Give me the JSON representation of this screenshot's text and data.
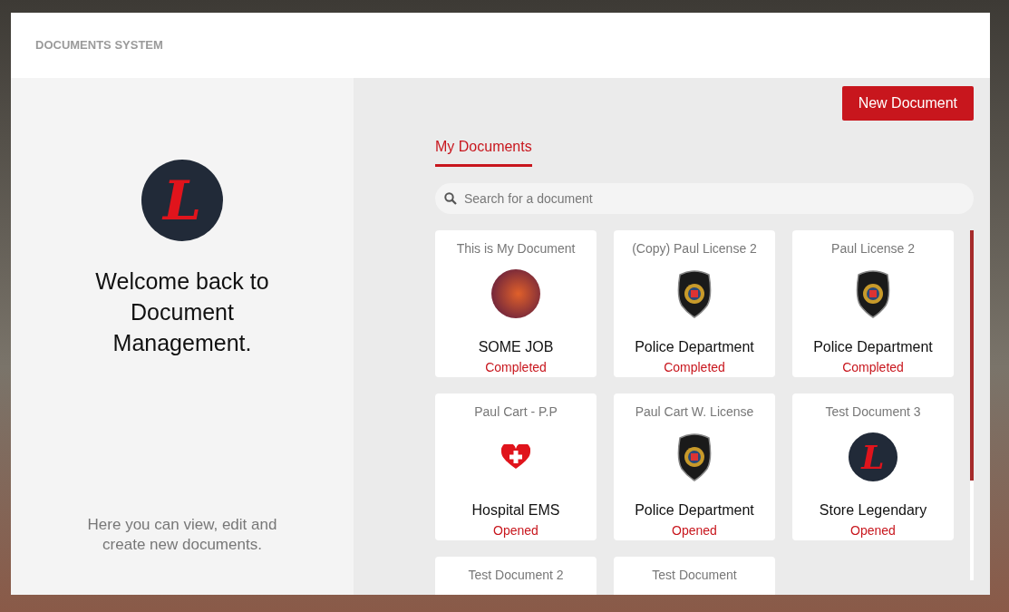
{
  "header": {
    "title": "DOCUMENTS SYSTEM"
  },
  "welcome": {
    "logo_letter": "L",
    "heading": "Welcome back to Document Management.",
    "description": "Here you can view, edit and create new documents."
  },
  "toolbar": {
    "new_button": "New Document"
  },
  "tabs": [
    {
      "label": "My Documents",
      "selected": true
    }
  ],
  "search": {
    "placeholder": "Search for a document"
  },
  "documents": [
    {
      "title": "This is My Document",
      "kind": "photo",
      "name": "SOME JOB",
      "status": "Completed"
    },
    {
      "title": "(Copy) Paul License 2",
      "kind": "badge",
      "name": "Police Department",
      "status": "Completed"
    },
    {
      "title": "Paul License 2",
      "kind": "badge",
      "name": "Police Department",
      "status": "Completed"
    },
    {
      "title": "Paul Cart - P.P",
      "kind": "medical",
      "name": "Hospital EMS",
      "status": "Opened"
    },
    {
      "title": "Paul Cart W. License",
      "kind": "badge",
      "name": "Police Department",
      "status": "Opened"
    },
    {
      "title": "Test Document 3",
      "kind": "logo",
      "letter": "L",
      "name": "Store Legendary",
      "status": "Opened"
    },
    {
      "title": "Test Document 2"
    },
    {
      "title": "Test Document"
    }
  ]
}
